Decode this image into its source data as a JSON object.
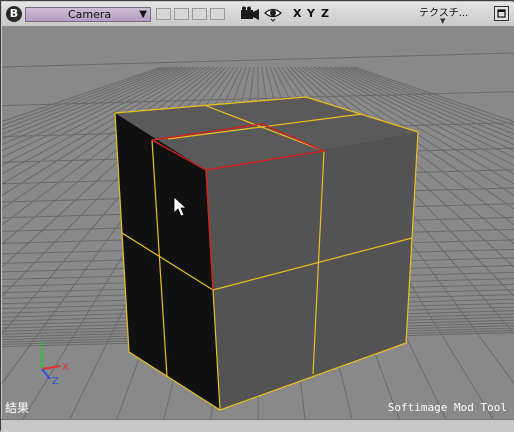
{
  "toolbar": {
    "badge": "B",
    "camera_label": "Camera",
    "dropdown_arrow": "▼",
    "axis_x": "X",
    "axis_y": "Y",
    "axis_z": "Z",
    "texture_menu": "テクスチ...",
    "icons": [
      "camera-icon",
      "eye-icon",
      "maximize-icon"
    ]
  },
  "viewport": {
    "result_label": "結果",
    "watermark": "Softimage Mod Tool",
    "axis_gizmo": {
      "x": "X",
      "y": "Y",
      "z": "Z"
    },
    "colors": {
      "background": "#898989",
      "grid": "#6a6a6a",
      "edge_selected": "#e8c020",
      "edge_highlight": "#d02020",
      "face_front": "#535353",
      "face_side": "#111111",
      "face_top": "#5a5a5a",
      "axis_x": "#e03030",
      "axis_y": "#30c030",
      "axis_z": "#3050e0"
    }
  }
}
